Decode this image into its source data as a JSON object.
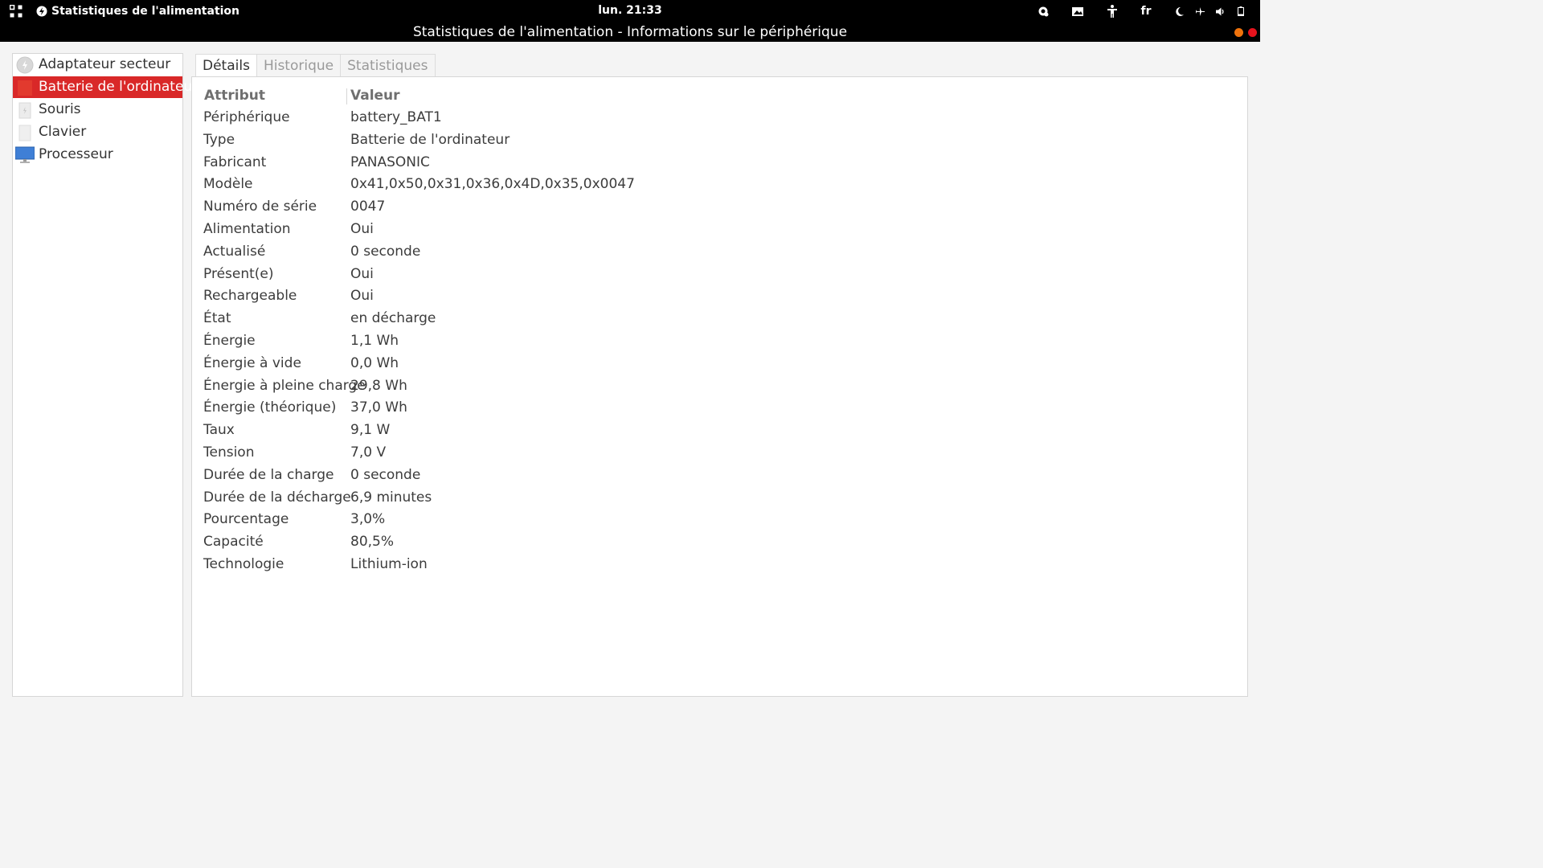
{
  "top_panel": {
    "app_name": "Statistiques de l'alimentation",
    "clock": "lun. 21:33",
    "language": "fr",
    "icons": [
      "activities-icon",
      "power-statistics-icon",
      "settings-icon",
      "screenshot-icon",
      "accessibility-icon",
      "night-light-icon",
      "airplane-mode-icon",
      "volume-icon",
      "battery-icon"
    ]
  },
  "window": {
    "title": "Statistiques de l'alimentation - Informations sur le périphérique",
    "button_colors": {
      "minimize": "#f0730c",
      "close": "#e5131d"
    }
  },
  "sidebar": {
    "items": [
      {
        "label": "Adaptateur secteur",
        "icon": "ac-adapter-icon",
        "selected": false
      },
      {
        "label": "Batterie de l'ordinateur",
        "icon": "battery-icon",
        "selected": true
      },
      {
        "label": "Souris",
        "icon": "mouse-battery-icon",
        "selected": false
      },
      {
        "label": "Clavier",
        "icon": "keyboard-battery-icon",
        "selected": false
      },
      {
        "label": "Processeur",
        "icon": "processor-monitor-icon",
        "selected": false
      }
    ],
    "selected_color": "#d92828"
  },
  "tabs": [
    {
      "label": "Détails",
      "active": true
    },
    {
      "label": "Historique",
      "active": false
    },
    {
      "label": "Statistiques",
      "active": false
    }
  ],
  "details": {
    "headers": {
      "attribute": "Attribut",
      "value": "Valeur"
    },
    "rows": [
      {
        "attribute": "Périphérique",
        "value": "battery_BAT1"
      },
      {
        "attribute": "Type",
        "value": "Batterie de l'ordinateur"
      },
      {
        "attribute": "Fabricant",
        "value": "PANASONIC"
      },
      {
        "attribute": "Modèle",
        "value": "0x41,0x50,0x31,0x36,0x4D,0x35,0x0047"
      },
      {
        "attribute": "Numéro de série",
        "value": "0047"
      },
      {
        "attribute": "Alimentation",
        "value": "Oui"
      },
      {
        "attribute": "Actualisé",
        "value": "0 seconde"
      },
      {
        "attribute": "Présent(e)",
        "value": "Oui"
      },
      {
        "attribute": "Rechargeable",
        "value": "Oui"
      },
      {
        "attribute": "État",
        "value": "en décharge"
      },
      {
        "attribute": "Énergie",
        "value": "1,1 Wh"
      },
      {
        "attribute": "Énergie à vide",
        "value": "0,0 Wh"
      },
      {
        "attribute": "Énergie à pleine charge",
        "value": "29,8 Wh"
      },
      {
        "attribute": "Énergie (théorique)",
        "value": "37,0 Wh"
      },
      {
        "attribute": "Taux",
        "value": "9,1 W"
      },
      {
        "attribute": "Tension",
        "value": "7,0 V"
      },
      {
        "attribute": "Durée de la charge",
        "value": "0 seconde"
      },
      {
        "attribute": "Durée de la décharge",
        "value": "6,9 minutes"
      },
      {
        "attribute": "Pourcentage",
        "value": "3,0%"
      },
      {
        "attribute": "Capacité",
        "value": "80,5%"
      },
      {
        "attribute": "Technologie",
        "value": "Lithium-ion"
      }
    ]
  }
}
